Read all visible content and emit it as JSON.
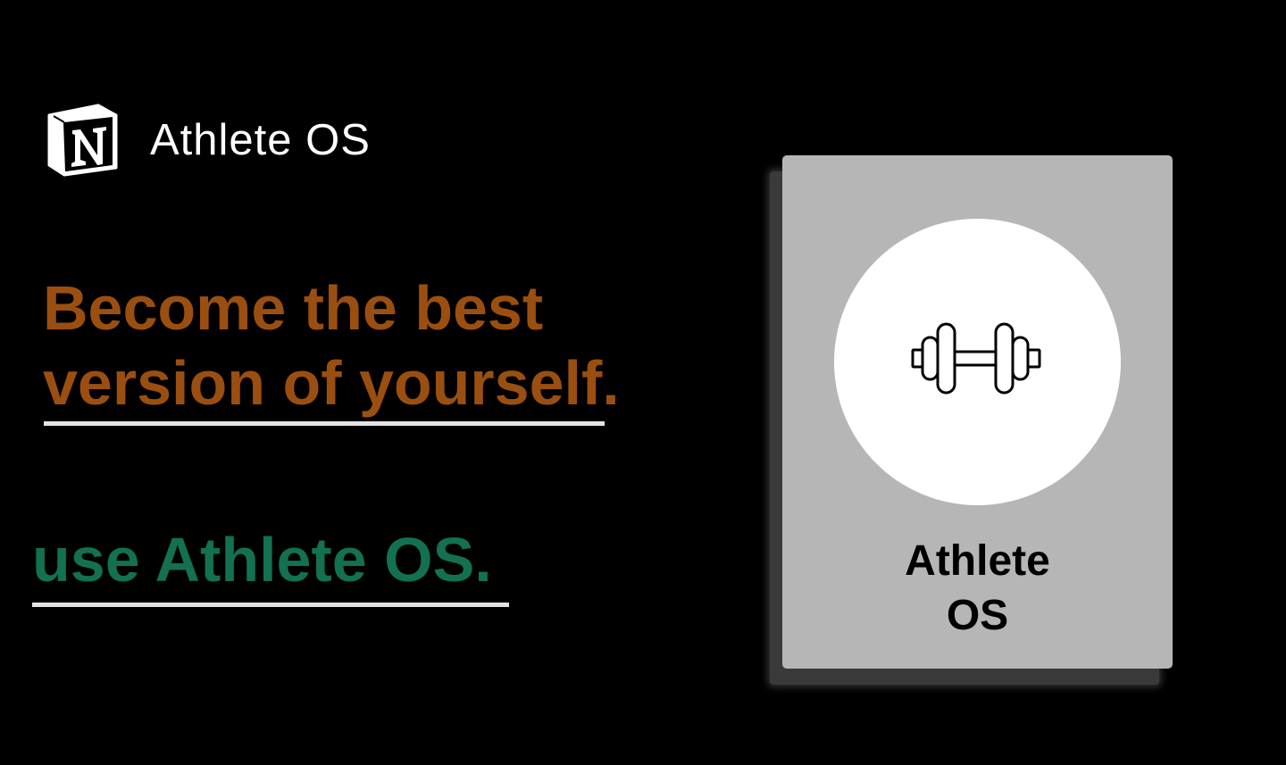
{
  "brand": {
    "logo": "notion-logo-icon",
    "name": "Athlete OS"
  },
  "headline": {
    "line1": "Become the best",
    "line2": "version of yourself."
  },
  "cta": {
    "text": "use Athlete OS."
  },
  "card": {
    "icon": "dumbbell-icon",
    "title_line1": "Athlete",
    "title_line2": "OS"
  },
  "colors": {
    "background": "#000000",
    "headline": "#9a4f11",
    "cta": "#13714f",
    "underline": "#e3e3e3",
    "card": "#b7b6b6"
  }
}
